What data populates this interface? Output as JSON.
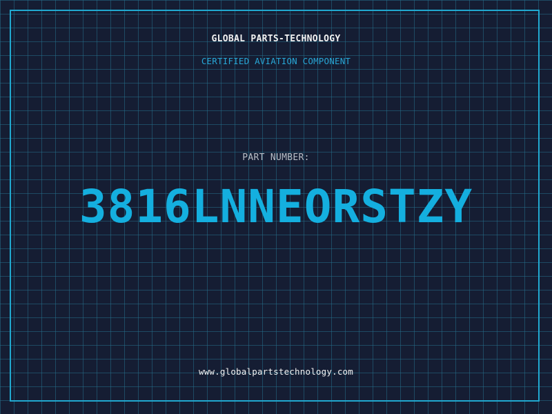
{
  "header": {
    "company_name": "GLOBAL PARTS-TECHNOLOGY",
    "subtitle": "CERTIFIED AVIATION COMPONENT"
  },
  "part": {
    "label": "PART NUMBER:",
    "number": "3816LNNEORSTZY"
  },
  "footer": {
    "website": "www.globalpartstechnology.com"
  },
  "colors": {
    "background": "#151d33",
    "grid": "#266e8a",
    "accent": "#14afdf",
    "text": "#f2f2f2"
  }
}
